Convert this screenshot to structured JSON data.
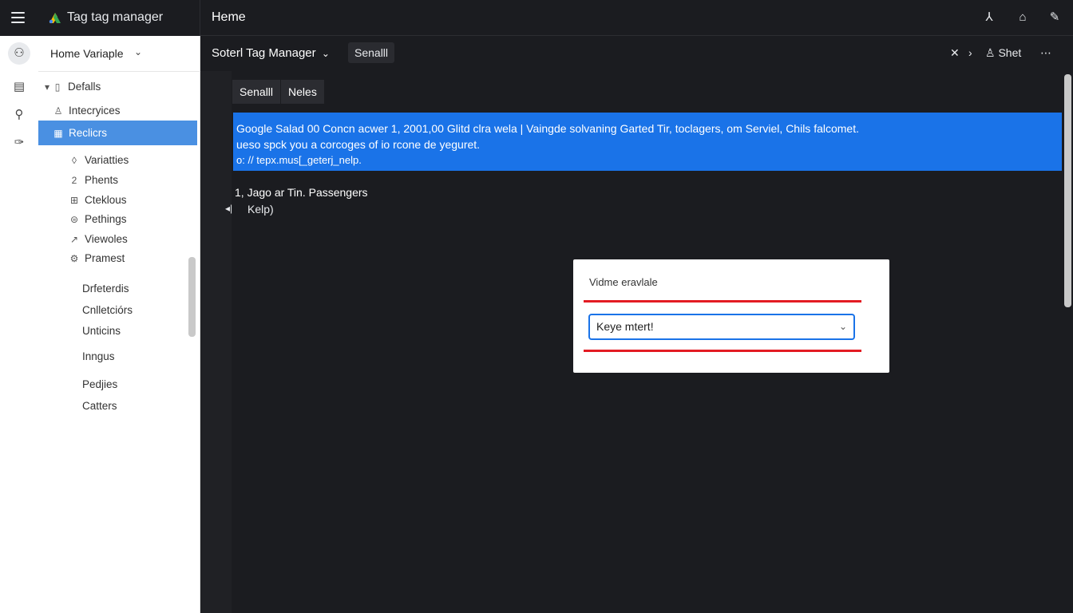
{
  "topbar": {
    "app_title": "Tag tag manager",
    "page_title": "Heme",
    "icons": [
      "menu-icon",
      "logo-icon",
      "tree-icon",
      "box-icon",
      "pen-icon"
    ]
  },
  "rail": {
    "icons": [
      "workspace-icon",
      "library-icon",
      "search-icon",
      "wrench-icon"
    ]
  },
  "sidebar": {
    "workspace_label": "Home Variaple",
    "items": [
      {
        "label": "Defalls",
        "icon": "folder-icon"
      },
      {
        "label": "Intecryices",
        "icon": "person-icon"
      },
      {
        "label": "Reclicrs",
        "icon": "table-icon"
      },
      {
        "label": "Variatties",
        "icon": "diamond-icon"
      },
      {
        "label": "Phents",
        "icon": "number-icon"
      },
      {
        "label": "Cteklous",
        "icon": "grid-icon"
      },
      {
        "label": "Pethings",
        "icon": "circle-icon"
      },
      {
        "label": "Viewoles",
        "icon": "arrow-icon"
      },
      {
        "label": "Pramest",
        "icon": "gear-icon"
      }
    ],
    "sub_items": [
      "Drfeterdis",
      "Cnlletciórs",
      "Unticins",
      "Inngus",
      "Pedjies",
      "Catters"
    ]
  },
  "toolbar": {
    "dropdown_label": "Soterl Tag Manager",
    "button_label": "Senalll",
    "close_symbol": "✕",
    "next_symbol": "›",
    "user_label": "Shet",
    "more_symbol": "⋯"
  },
  "tabs": [
    "Senalll",
    "Neles"
  ],
  "banner": {
    "line1": "Google Salad 00 Concn acwer 1, 2001,00 Glitd clra wela | Vaingde solvaning Garted Tir, toclagers, om Serviel, Chils falcomet.",
    "line2": "ueso spck you a corcoges of io rcone de yeguret.",
    "line3": "o: // tepx.mus[_geterj_nelp."
  },
  "list": {
    "title": "1, Jago ar Tin. Passengers",
    "sub": "Kelp)",
    "back_symbol": "◂|"
  },
  "card": {
    "label": "Vidme eravlale",
    "select_value": "Keye mtert!"
  },
  "colors": {
    "accent": "#1a73e8",
    "selected": "#4a90e2",
    "error": "#e31b23",
    "background": "#1b1c20"
  }
}
